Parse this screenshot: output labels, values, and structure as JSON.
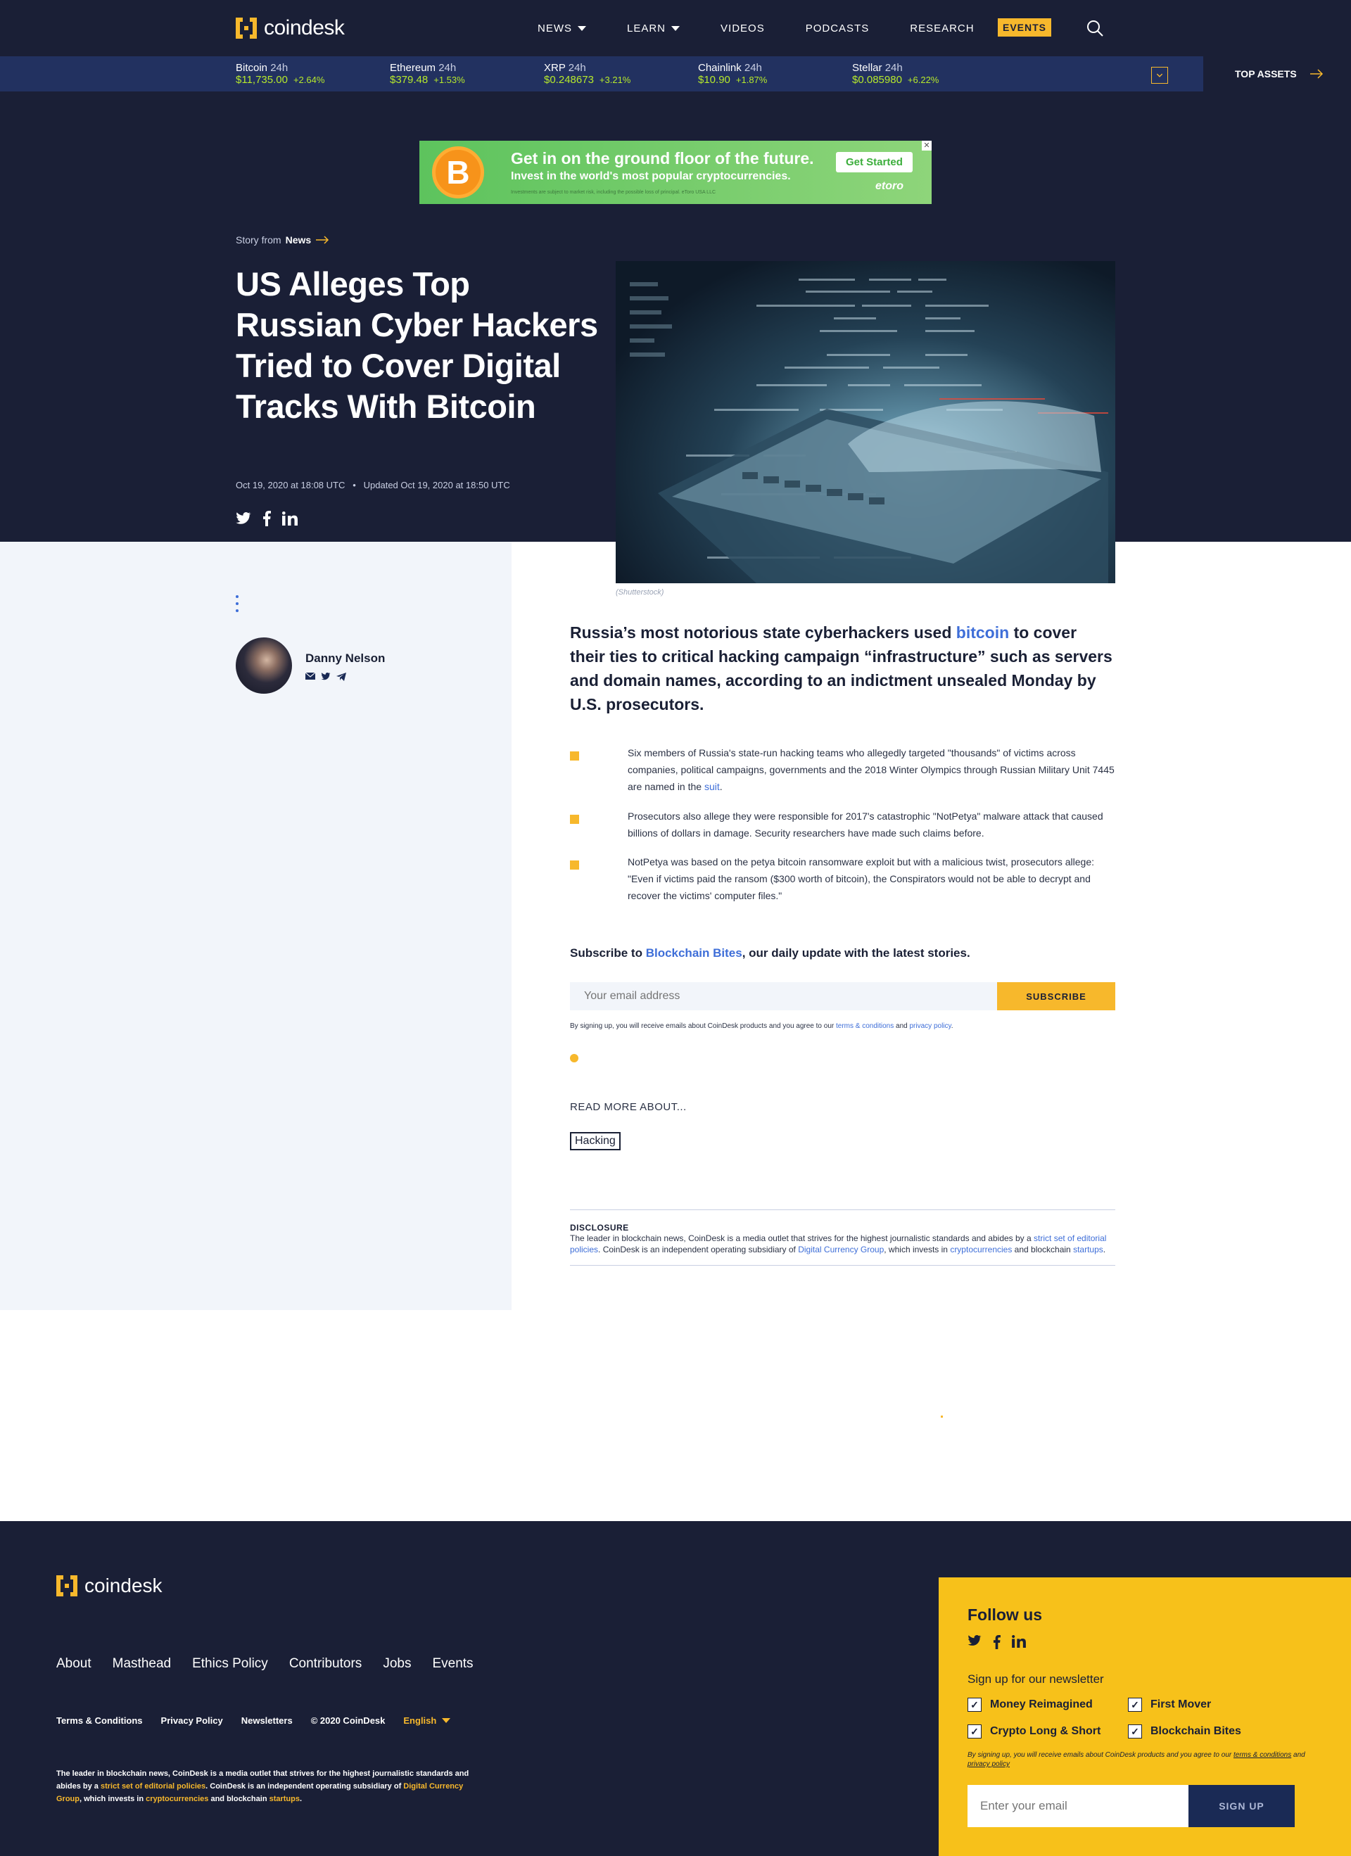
{
  "brand": {
    "name": "coindesk",
    "accent": "#f7b82c",
    "navy": "#1a1f36"
  },
  "nav": {
    "items": [
      {
        "label": "NEWS",
        "dropdown": true
      },
      {
        "label": "LEARN",
        "dropdown": true
      },
      {
        "label": "VIDEOS",
        "dropdown": false
      },
      {
        "label": "PODCASTS",
        "dropdown": false
      },
      {
        "label": "RESEARCH",
        "dropdown": false
      }
    ],
    "events_label": "EVENTS",
    "search_icon": "search-icon"
  },
  "ticker": {
    "assets": [
      {
        "name": "Bitcoin",
        "period": "24h",
        "price": "$11,735.00",
        "change": "+2.64%"
      },
      {
        "name": "Ethereum",
        "period": "24h",
        "price": "$379.48",
        "change": "+1.53%"
      },
      {
        "name": "XRP",
        "period": "24h",
        "price": "$0.248673",
        "change": "+3.21%"
      },
      {
        "name": "Chainlink",
        "period": "24h",
        "price": "$10.90",
        "change": "+1.87%"
      },
      {
        "name": "Stellar",
        "period": "24h",
        "price": "$0.085980",
        "change": "+6.22%"
      }
    ],
    "top_assets_label": "TOP ASSETS",
    "positive_color": "#b7ea2b"
  },
  "ad": {
    "headline": "Get in on the ground floor of the future.",
    "subline": "Invest in the world's most popular cryptocurrencies.",
    "disclaimer": "Investments are subject to market risk, including the possible loss of principal. eToro USA LLC",
    "cta": "Get Started",
    "brand": "etoro",
    "coin_glyph": "B"
  },
  "article": {
    "story_from_prefix": "Story from",
    "story_from_section": "News",
    "headline": "US Alleges Top Russian Cyber Hackers Tried to Cover Digital Tracks With Bitcoin",
    "published": "Oct 19, 2020 at 18:08 UTC",
    "updated": "Updated Oct 19, 2020 at 18:50 UTC",
    "image_caption": "(Shutterstock)",
    "author": "Danny Nelson",
    "lede_before": "Russia’s most notorious state cyberhackers used ",
    "lede_link": "bitcoin",
    "lede_after": " to cover their ties to critical hacking campaign “infrastructure” such as servers and domain names, according to an indictment unsealed Monday by U.S. prosecutors.",
    "bullets": [
      {
        "text": "Six members of Russia's state-run hacking teams who allegedly targeted \"thousands\" of victims across companies, political campaigns, governments and the 2018 Winter Olympics through Russian Military Unit 7445 are named in the ",
        "link": "suit",
        "after": "."
      },
      {
        "text": "Prosecutors also allege they were responsible for 2017's catastrophic \"NotPetya\" malware attack that caused billions of dollars in damage. Security researchers have made such claims before.",
        "link": "",
        "after": ""
      },
      {
        "text": "NotPetya was based on the petya bitcoin ransomware exploit but with a malicious twist, prosecutors allege: \"Even if victims paid the ransom ($300 worth of bitcoin), the Conspirators would not be able to decrypt and recover the victims' computer files.\"",
        "link": "",
        "after": ""
      }
    ]
  },
  "subscribe": {
    "prefix": "Subscribe to ",
    "newsletter": "Blockchain Bites",
    "suffix": ", our daily update with the latest stories.",
    "placeholder": "Your email address",
    "button": "SUBSCRIBE",
    "legal_before": "By signing up, you will receive emails about CoinDesk products and you agree to our ",
    "legal_terms": "terms & conditions",
    "legal_and": " and ",
    "legal_privacy": "privacy policy",
    "legal_end": "."
  },
  "read_more": {
    "label": "READ MORE ABOUT...",
    "tags": [
      "Hacking"
    ]
  },
  "disclosure": {
    "title": "DISCLOSURE",
    "t1": "The leader in blockchain news, CoinDesk is a media outlet that strives for the highest journalistic standards and abides by a ",
    "l1": "strict set of editorial policies",
    "t2": ". CoinDesk is an independent operating subsidiary of ",
    "l2": "Digital Currency Group",
    "t3": ", which invests in ",
    "l3": "cryptocurrencies",
    "t4": " and blockchain ",
    "l4": "startups",
    "t5": "."
  },
  "footer": {
    "links": [
      "About",
      "Masthead",
      "Ethics Policy",
      "Contributors",
      "Jobs",
      "Events"
    ],
    "terms": "Terms & Conditions",
    "privacy": "Privacy Policy",
    "newsletters": "Newsletters",
    "copyright": "© 2020 CoinDesk",
    "language": "English",
    "follow_title": "Follow us",
    "newsletter_title": "Sign up for our newsletter",
    "newsletters_list": [
      "Money Reimagined",
      "First Mover",
      "Crypto Long & Short",
      "Blockchain Bites"
    ],
    "nl_legal_before": "By signing up, you will receive emails about CoinDesk products and you agree to our ",
    "nl_legal_terms": "terms & conditions",
    "nl_legal_and": " and ",
    "nl_legal_privacy": "privacy policy",
    "nl_placeholder": "Enter your email",
    "nl_button": "SIGN UP"
  }
}
